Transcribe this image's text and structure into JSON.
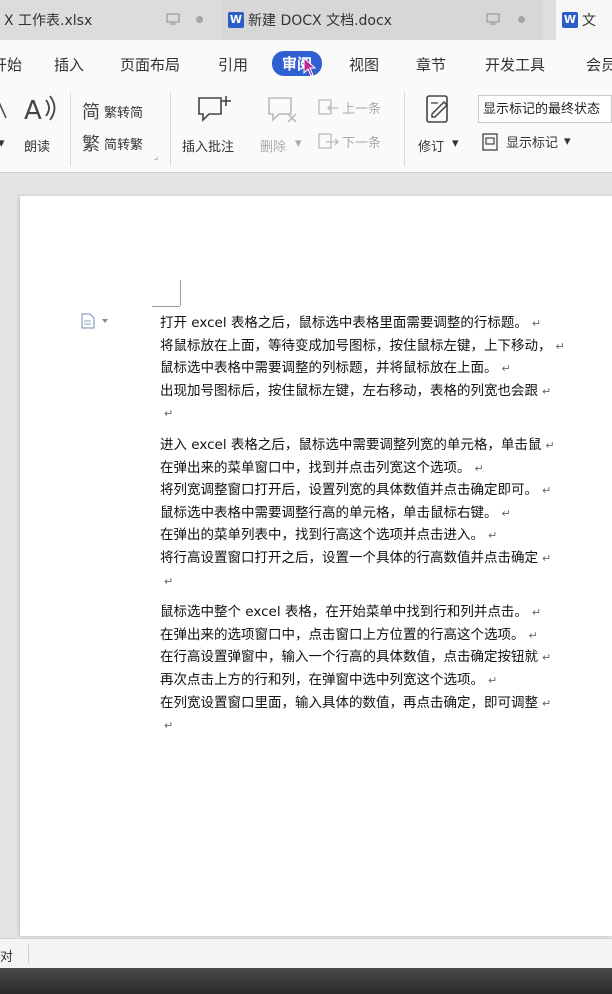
{
  "tabs": [
    {
      "label": "X 工作表.xlsx"
    },
    {
      "label": "新建 DOCX 文档.docx"
    },
    {
      "label": "文"
    }
  ],
  "menu": [
    {
      "label": "开始"
    },
    {
      "label": "插入"
    },
    {
      "label": "页面布局"
    },
    {
      "label": "引用"
    },
    {
      "label": "审阅"
    },
    {
      "label": "视图"
    },
    {
      "label": "章节"
    },
    {
      "label": "开发工具"
    },
    {
      "label": "会员"
    }
  ],
  "ribbon": {
    "read_aloud": "朗读",
    "trad_to_simp": "繁转简",
    "simp_to_trad": "简转繁",
    "insert_comment": "插入批注",
    "delete": "删除",
    "prev_item": "上一条",
    "next_item": "下一条",
    "track_changes": "修订",
    "show_markup_value": "显示标记的最终状态",
    "show_markup": "显示标记"
  },
  "document": {
    "paragraphs": [
      [
        "打开 excel 表格之后，鼠标选中表格里面需要调整的行标题。",
        "将鼠标放在上面，等待变成加号图标，按住鼠标左键，上下移动，",
        "鼠标选中表格中需要调整的列标题，并将鼠标放在上面。",
        "出现加号图标后，按住鼠标左键，左右移动，表格的列宽也会跟"
      ],
      [
        "进入 excel 表格之后，鼠标选中需要调整列宽的单元格，单击鼠",
        "在弹出来的菜单窗口中，找到并点击列宽这个选项。",
        "将列宽调整窗口打开后，设置列宽的具体数值并点击确定即可。",
        "鼠标选中表格中需要调整行高的单元格，单击鼠标右键。",
        "在弹出的菜单列表中，找到行高这个选项并点击进入。",
        "将行高设置窗口打开之后，设置一个具体的行高数值并点击确定"
      ],
      [
        "鼠标选中整个 excel 表格，在开始菜单中找到行和列并点击。",
        "在弹出来的选项窗口中，点击窗口上方位置的行高这个选项。",
        "在行高设置弹窗中，输入一个行高的具体数值，点击确定按钮就",
        "再次点击上方的行和列，在弹窗中选中列宽这个选项。",
        "在列宽设置窗口里面，输入具体的数值，再点击确定，即可调整"
      ]
    ],
    "paragraph_mark": "↵"
  },
  "status": {
    "left_text": "对"
  },
  "colors": {
    "accent": "#2f5fd0",
    "word_icon": "#2b5cc8"
  }
}
